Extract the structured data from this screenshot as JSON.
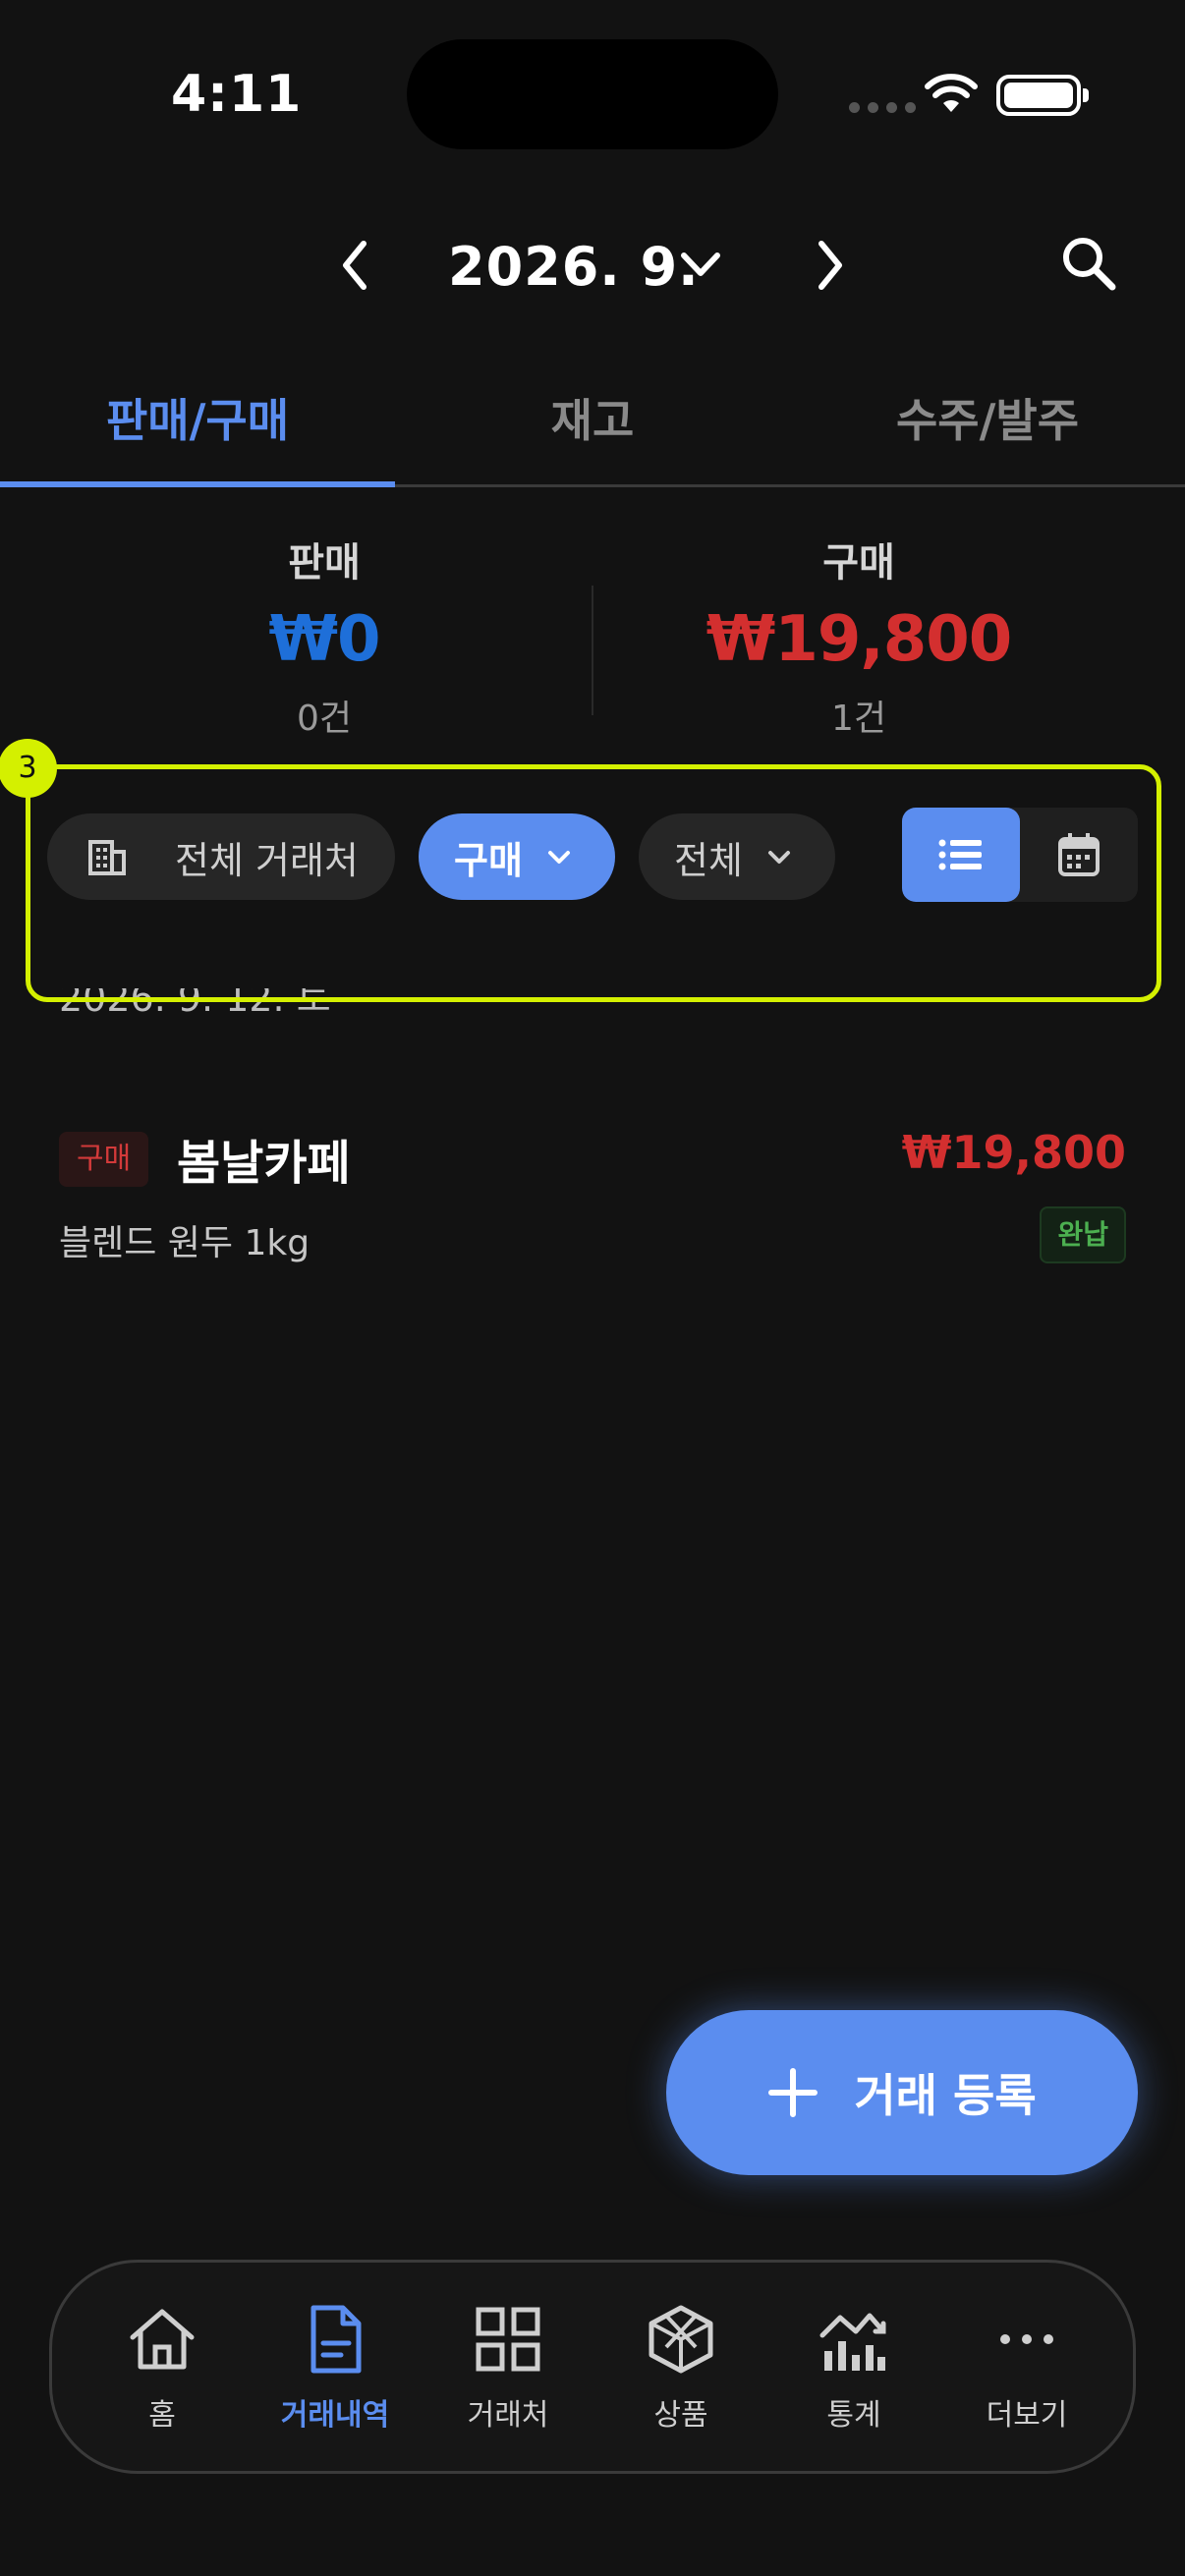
{
  "status_bar": {
    "time": "4:11"
  },
  "header": {
    "month": "2026. 9."
  },
  "tabs": [
    {
      "label": "판매/구매",
      "active": true
    },
    {
      "label": "재고",
      "active": false
    },
    {
      "label": "수주/발주",
      "active": false
    }
  ],
  "summary": {
    "sale": {
      "label": "판매",
      "amount": "₩0",
      "count": "0건",
      "color": "#1e6fd9"
    },
    "purchase": {
      "label": "구매",
      "amount": "₩19,800",
      "count": "1건",
      "color": "#d32f2f"
    }
  },
  "filters": {
    "badge": "3",
    "partner": "전체 거래처",
    "type": "구매",
    "status": "전체",
    "view_modes": [
      "list",
      "calendar"
    ],
    "active_view": "list"
  },
  "list": {
    "date": "2026. 9. 12. 토",
    "items": [
      {
        "type": "구매",
        "name": "봄날카페",
        "amount": "₩19,800",
        "product": "블렌드 원두 1kg",
        "status": "완납"
      }
    ]
  },
  "fab": {
    "label": "거래 등록"
  },
  "bottom_nav": [
    {
      "label": "홈",
      "icon": "home-icon",
      "active": false
    },
    {
      "label": "거래내역",
      "icon": "document-icon",
      "active": true
    },
    {
      "label": "거래처",
      "icon": "grid-icon",
      "active": false
    },
    {
      "label": "상품",
      "icon": "box-icon",
      "active": false
    },
    {
      "label": "통계",
      "icon": "chart-icon",
      "active": false
    },
    {
      "label": "더보기",
      "icon": "more-icon",
      "active": false
    }
  ],
  "colors": {
    "accent": "#5b8def",
    "highlight": "#d4f000",
    "background": "#121212"
  }
}
